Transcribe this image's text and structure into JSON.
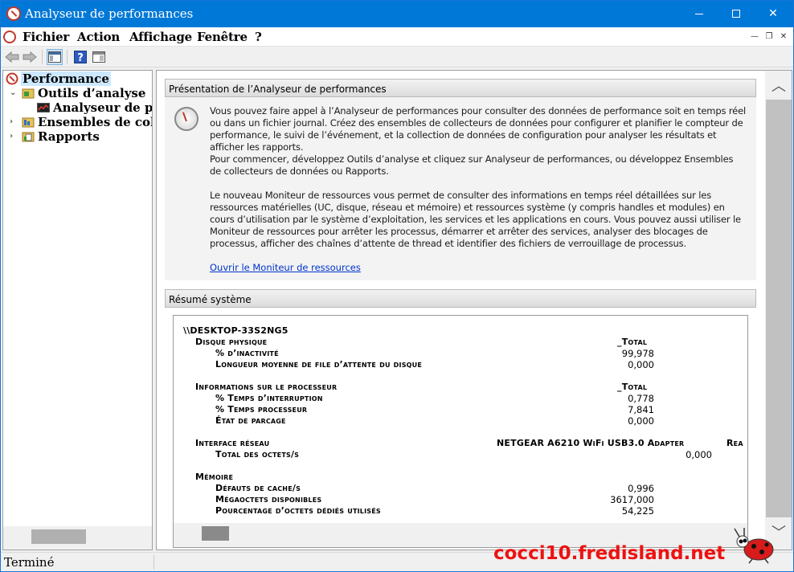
{
  "window": {
    "title": "Analyseur de performances"
  },
  "menu": {
    "items": [
      "Fichier",
      "Action",
      "Affichage",
      "Fenêtre",
      "?"
    ]
  },
  "tree": {
    "items": [
      {
        "label": "Performance",
        "selected": true
      },
      {
        "label": "Outils d’analyse"
      },
      {
        "label": "Analyseur de per"
      },
      {
        "label": "Ensembles de collec"
      },
      {
        "label": "Rapports"
      }
    ]
  },
  "intro": {
    "header": "Présentation de l’Analyseur de performances",
    "p1": "Vous pouvez faire appel à l’Analyseur de performances pour consulter des données de performance soit en temps réel ou dans un fichier journal. Créez des ensembles de collecteurs de données pour configurer et planifier le compteur de performance, le suivi de l’événement, et la collection de données de configuration pour analyser les résultats et afficher les rapports.",
    "p2": "Pour commencer, développez Outils d’analyse et cliquez sur Analyseur de performances, ou développez Ensembles de collecteurs de données ou Rapports.",
    "p3": "Le nouveau Moniteur de ressources vous permet de consulter des informations en temps réel détaillées sur les ressources matérielles (UC, disque, réseau et mémoire) et ressources système (y compris handles et modules) en cours d’utilisation par le système d’exploitation, les services et les applications en cours. Vous pouvez aussi utiliser le Moniteur de ressources pour arrêter les processus, démarrer et arrêter des services, analyser des blocages de processus, afficher des chaînes d’attente de thread et identifier des fichiers de verrouillage de processus.",
    "link": "Ouvrir le Moniteur de ressources"
  },
  "summary": {
    "header": "Résumé système",
    "machine": "\\\\DESKTOP-33S2NG5",
    "disk": {
      "label": "Disque physique",
      "instance": "_Total",
      "counters": [
        {
          "name": "% d’inactivité",
          "value": "99,978"
        },
        {
          "name": "Longueur moyenne de file d’attente du disque",
          "value": "0,000"
        }
      ]
    },
    "cpu": {
      "label": "Informations sur le processeur",
      "instance": "_Total",
      "counters": [
        {
          "name": "% Temps d’interruption",
          "value": "0,778"
        },
        {
          "name": "% Temps processeur",
          "value": "7,841"
        },
        {
          "name": "État de parcage",
          "value": "0,000"
        }
      ]
    },
    "network": {
      "label": "Interface réseau",
      "instance": "NETGEAR A6210 WiFi USB3.0 Adapter",
      "instance2": "Rea",
      "counters": [
        {
          "name": "Total des octets/s",
          "value": "0,000"
        }
      ]
    },
    "memory": {
      "label": "Mémoire",
      "counters": [
        {
          "name": "Défauts de cache/s",
          "value": "0,996"
        },
        {
          "name": "Mégaoctets disponibles",
          "value": "3617,000"
        },
        {
          "name": "Pourcentage d’octets dédiés utilisés",
          "value": "54,225"
        }
      ]
    }
  },
  "status": {
    "text": "Terminé"
  },
  "watermark": "cocci10.fredisland.net",
  "colors": {
    "titlebar": "#0078d7",
    "link": "#0033cc",
    "watermark": "#ee1111",
    "selection": "#cce8ff"
  }
}
